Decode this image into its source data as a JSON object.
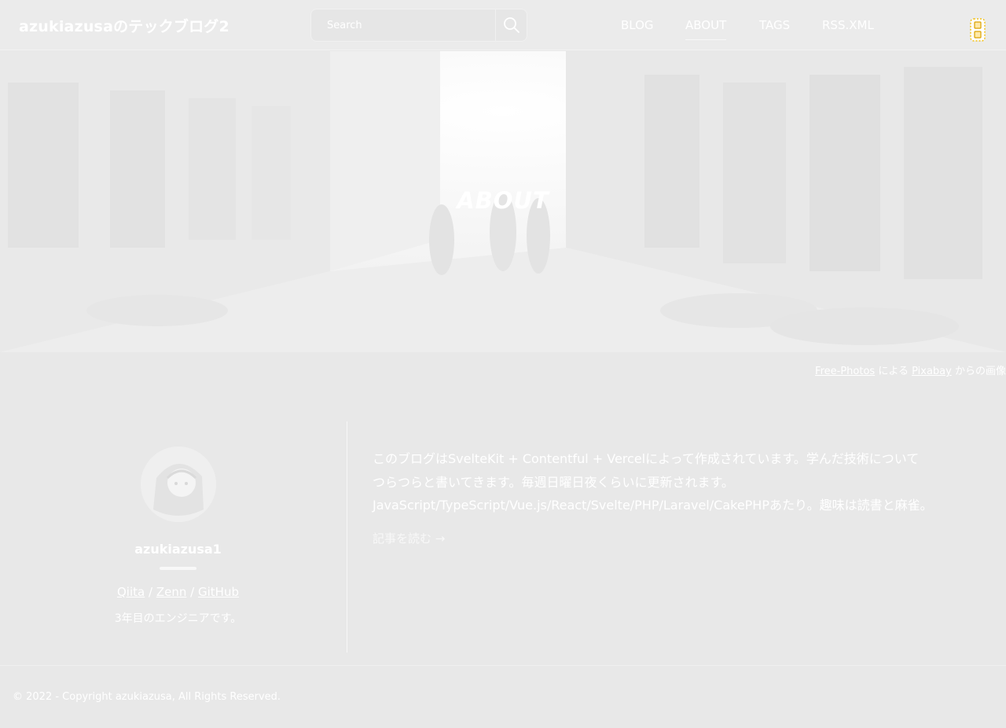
{
  "header": {
    "site_title": "azukiazusaのテックブログ2",
    "search": {
      "placeholder": "Search",
      "value": ""
    },
    "nav": [
      {
        "label": "BLOG",
        "active": false
      },
      {
        "label": "ABOUT",
        "active": true
      },
      {
        "label": "TAGS",
        "active": false
      },
      {
        "label": "RSS.XML",
        "active": false
      }
    ],
    "theme_icon": "sun-icon"
  },
  "hero": {
    "title": "ABOUT"
  },
  "credit": {
    "author_link": "Free-Photos",
    "text_mid": "による",
    "site_link": "Pixabay",
    "text_end": "からの画像"
  },
  "profile": {
    "name": "azukiazusa1",
    "links": [
      {
        "label": "Qiita"
      },
      {
        "label": "Zenn"
      },
      {
        "label": "GitHub"
      }
    ],
    "separator": "/",
    "description": "3年目のエンジニアです。"
  },
  "about": {
    "lines": [
      "このブログはSvelteKit + Contentful + Vercelによって作成されています。学んだ技術について",
      "つらつらと書いてきます。毎週日曜日夜くらいに更新されます。",
      "JavaScript/TypeScript/Vue.js/React/Svelte/PHP/Laravel/CakePHPあたり。趣味は読書と麻雀。"
    ],
    "read_more": "記事を読む →"
  },
  "footer": {
    "copyright": "© 2022 - Copyright azukiazusa, All Rights Reserved."
  }
}
